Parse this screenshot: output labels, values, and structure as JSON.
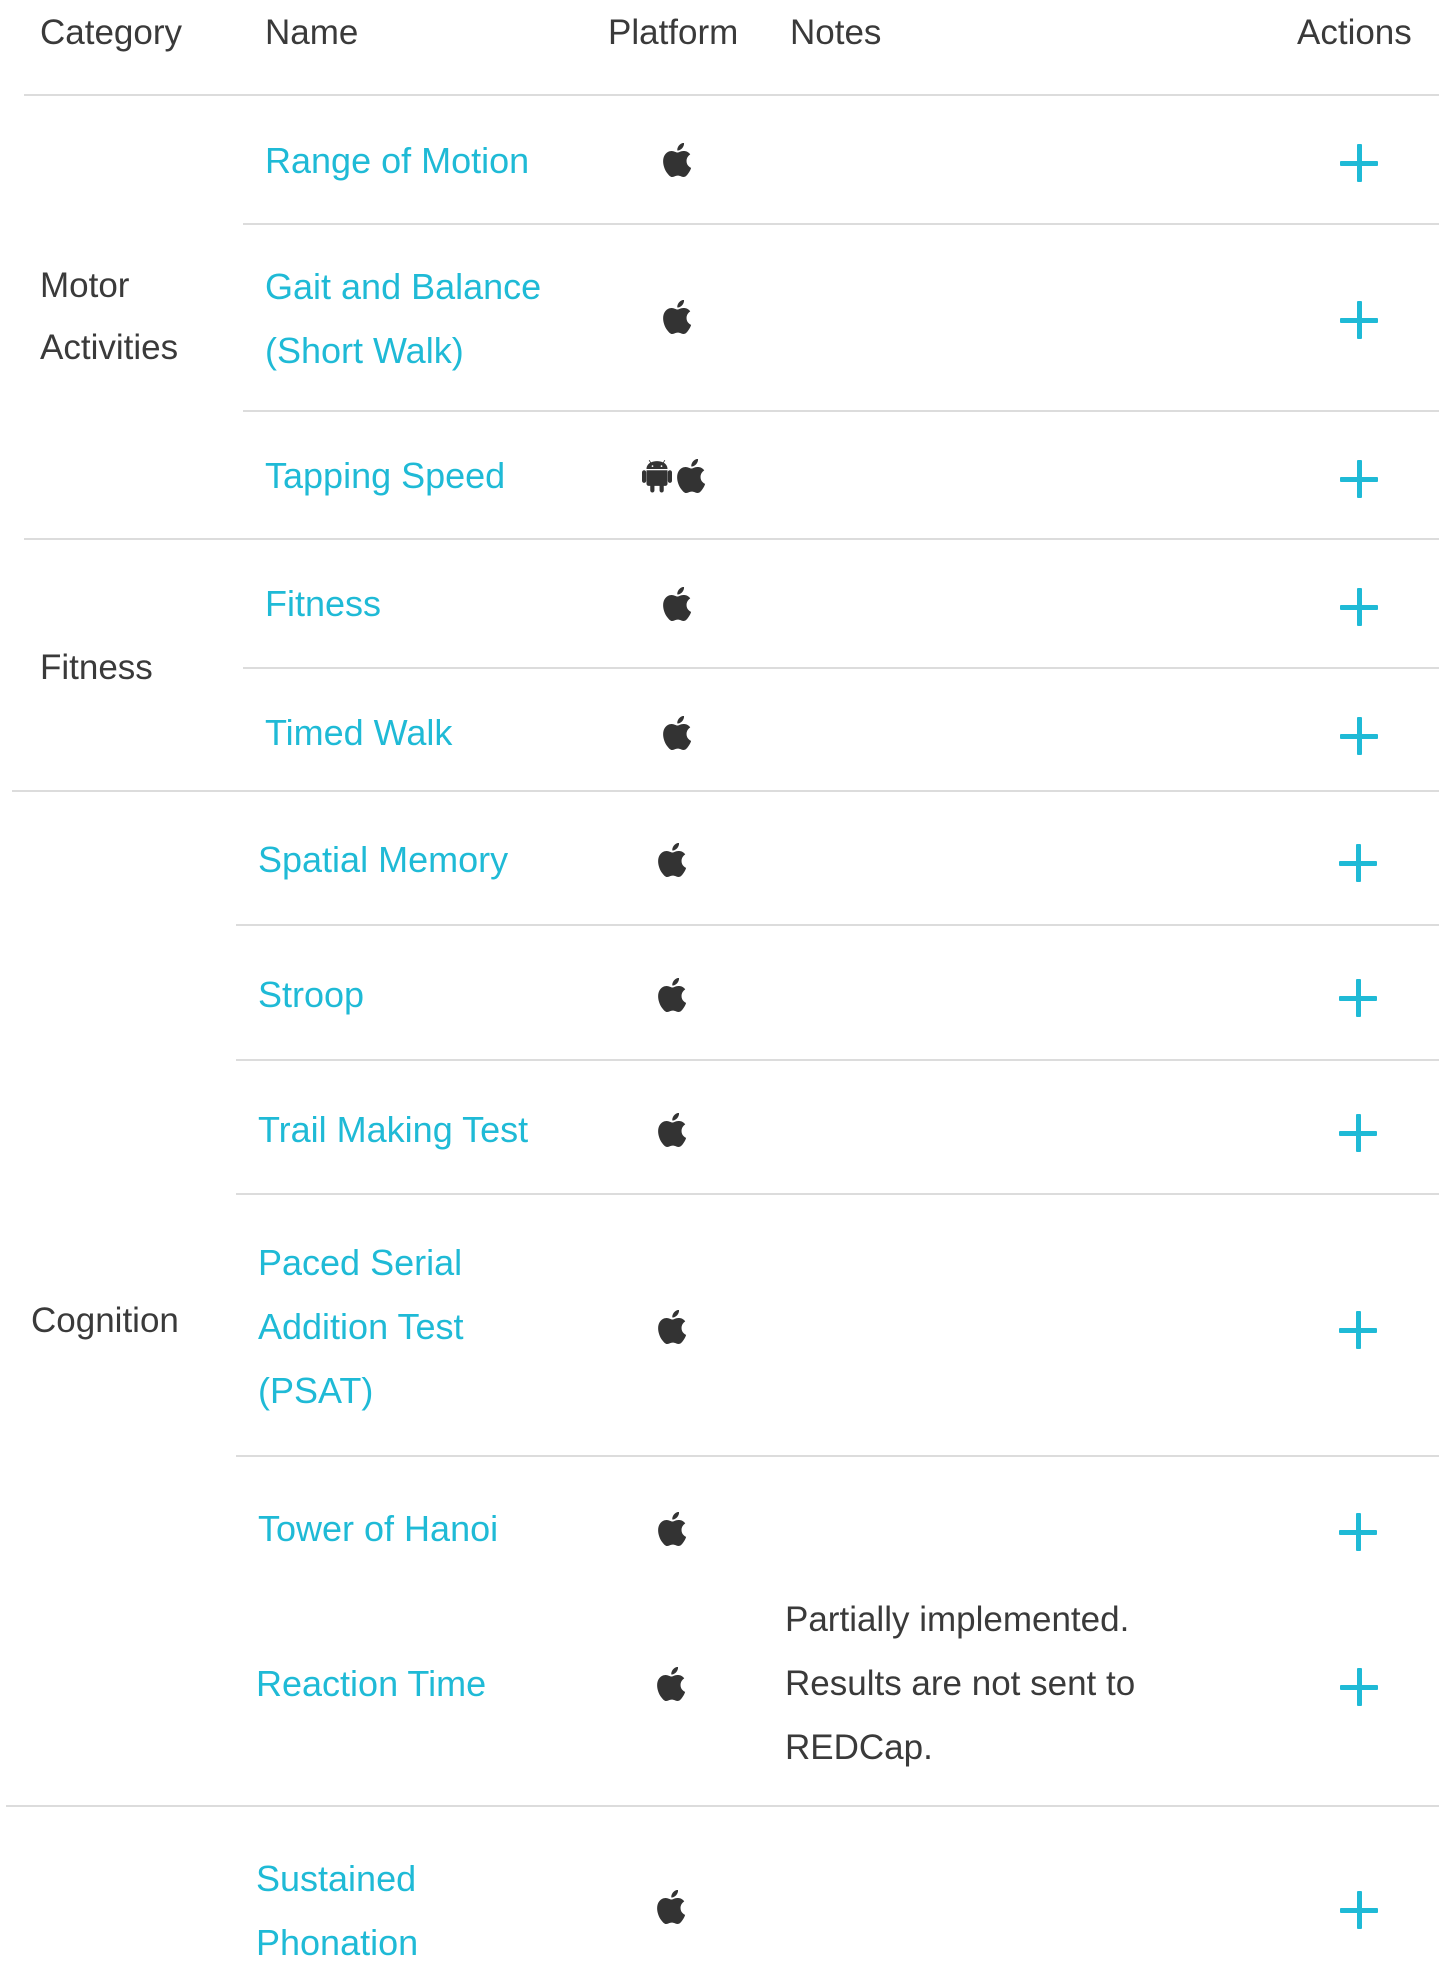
{
  "header": {
    "category": "Category",
    "name": "Name",
    "platform": "Platform",
    "notes": "Notes",
    "actions": "Actions"
  },
  "categories": {
    "motor_line1": "Motor",
    "motor_line2": "Activities",
    "fitness": "Fitness",
    "cognition": "Cognition"
  },
  "activities": [
    {
      "name_lines": [
        "Range of Motion"
      ],
      "platforms": [
        "apple-icon"
      ]
    },
    {
      "name_lines": [
        "Gait and Balance",
        "(Short Walk)"
      ],
      "platforms": [
        "apple-icon"
      ]
    },
    {
      "name_lines": [
        "Tapping Speed"
      ],
      "platforms": [
        "android-icon",
        "apple-icon"
      ]
    },
    {
      "name_lines": [
        "Fitness"
      ],
      "platforms": [
        "apple-icon"
      ]
    },
    {
      "name_lines": [
        "Timed Walk"
      ],
      "platforms": [
        "apple-icon"
      ]
    },
    {
      "name_lines": [
        "Spatial Memory"
      ],
      "platforms": [
        "apple-icon"
      ]
    },
    {
      "name_lines": [
        "Stroop"
      ],
      "platforms": [
        "apple-icon"
      ]
    },
    {
      "name_lines": [
        "Trail Making Test"
      ],
      "platforms": [
        "apple-icon"
      ]
    },
    {
      "name_lines": [
        "Paced Serial",
        "Addition Test",
        "(PSAT)"
      ],
      "platforms": [
        "apple-icon"
      ]
    },
    {
      "name_lines": [
        "Tower of Hanoi"
      ],
      "platforms": [
        "apple-icon"
      ]
    },
    {
      "name_lines": [
        "Reaction Time"
      ],
      "platforms": [
        "apple-icon"
      ],
      "notes": [
        "Partially implemented.",
        "Results are not sent to",
        "REDCap."
      ]
    },
    {
      "name_lines": [
        "Sustained",
        "Phonation"
      ],
      "platforms": [
        "apple-icon"
      ]
    }
  ],
  "colors": {
    "link": "#1fbad6",
    "text": "#3a3a3a",
    "divider": "#dcdcdc",
    "icon": "#333333"
  }
}
